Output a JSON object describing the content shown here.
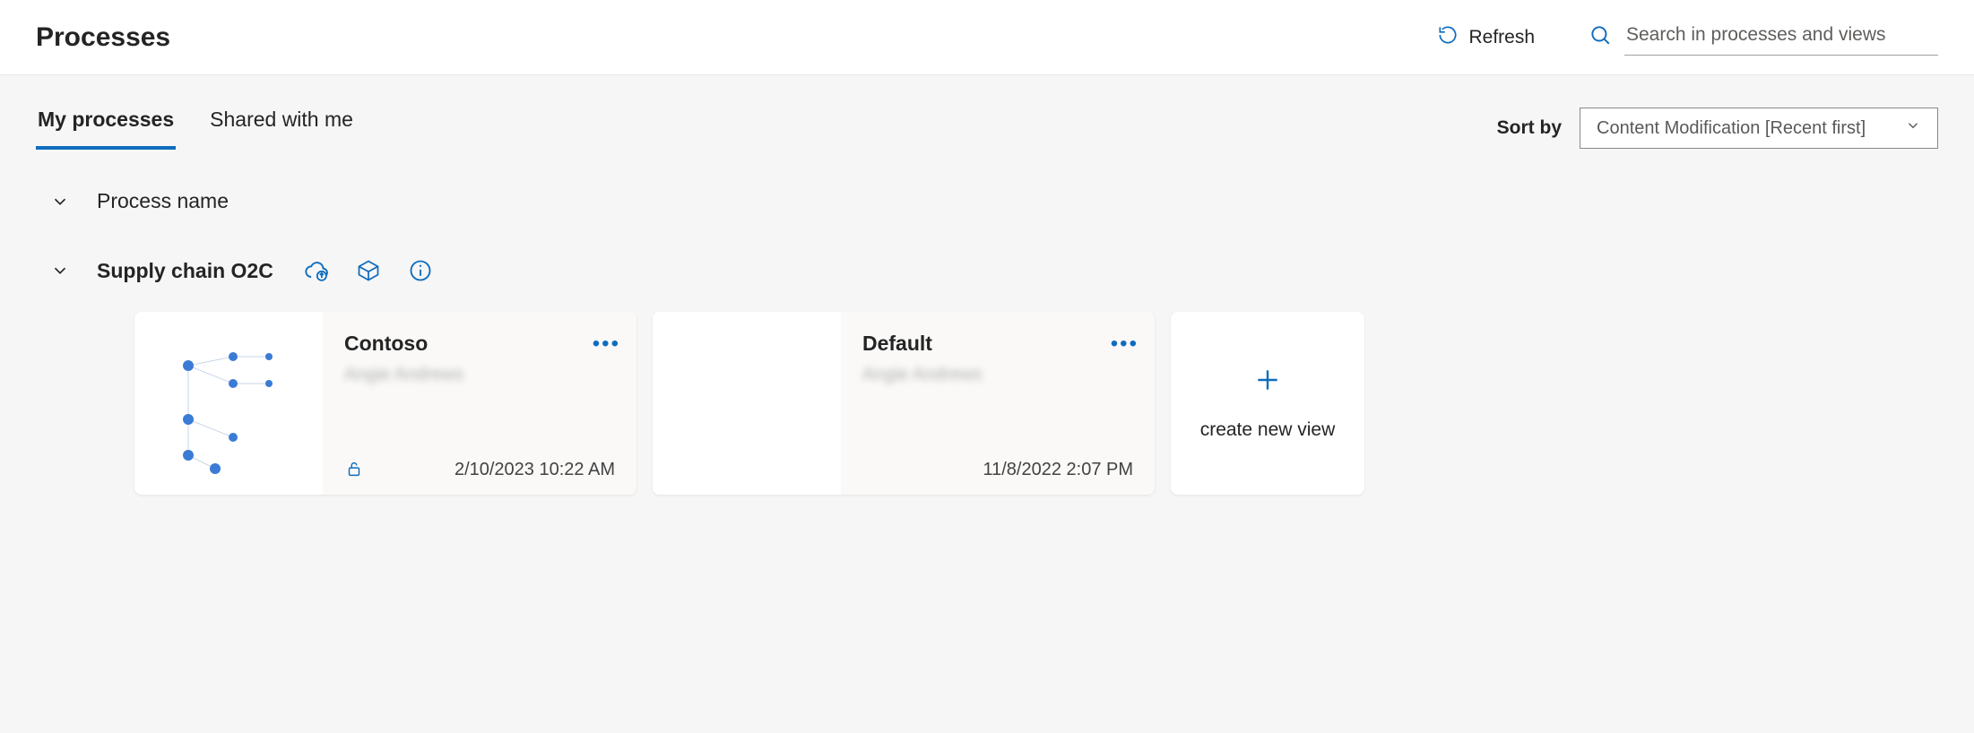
{
  "header": {
    "title": "Processes",
    "refresh_label": "Refresh",
    "search_placeholder": "Search in processes and views"
  },
  "tabs": {
    "my_processes": "My processes",
    "shared_with_me": "Shared with me"
  },
  "sort": {
    "label": "Sort by",
    "selected": "Content Modification [Recent first]"
  },
  "tree": {
    "root_label": "Process name",
    "process": {
      "name": "Supply chain O2C"
    }
  },
  "views": [
    {
      "title": "Contoso",
      "author": "Angie Andrews",
      "modified": "2/10/2023 10:22 AM",
      "locked": true,
      "has_thumb": true
    },
    {
      "title": "Default",
      "author": "Angie Andrews",
      "modified": "11/8/2022 2:07 PM",
      "locked": false,
      "has_thumb": false
    }
  ],
  "create_view_label": "create new view"
}
